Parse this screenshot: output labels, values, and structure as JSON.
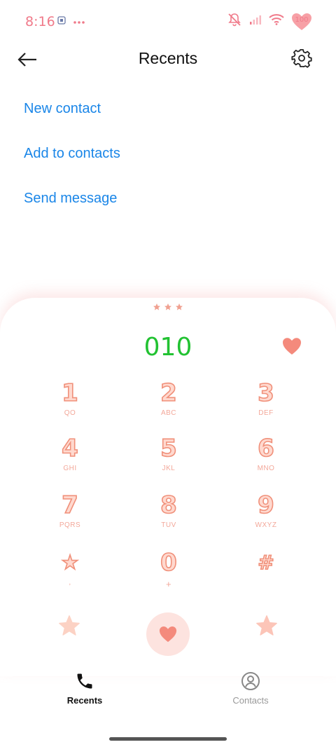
{
  "status_bar": {
    "time": "8:16",
    "battery": "100"
  },
  "header": {
    "title": "Recents"
  },
  "actions": [
    {
      "label": "New contact"
    },
    {
      "label": "Add to contacts"
    },
    {
      "label": "Send message"
    }
  ],
  "dialer": {
    "number": "010",
    "keys": [
      {
        "digit": "1",
        "letters": "QO"
      },
      {
        "digit": "2",
        "letters": "ABC"
      },
      {
        "digit": "3",
        "letters": "DEF"
      },
      {
        "digit": "4",
        "letters": "GHI"
      },
      {
        "digit": "5",
        "letters": "JKL"
      },
      {
        "digit": "6",
        "letters": "MNO"
      },
      {
        "digit": "7",
        "letters": "PQRS"
      },
      {
        "digit": "8",
        "letters": "TUV"
      },
      {
        "digit": "9",
        "letters": "WXYZ"
      },
      {
        "digit": "★",
        "letters": ","
      },
      {
        "digit": "0",
        "letters": "+"
      },
      {
        "digit": "#",
        "letters": ""
      }
    ]
  },
  "nav": {
    "recents": "Recents",
    "contacts": "Contacts"
  },
  "colors": {
    "accent_link": "#1a86e8",
    "number_green": "#22c232",
    "theme_pink": "#f0907a"
  }
}
